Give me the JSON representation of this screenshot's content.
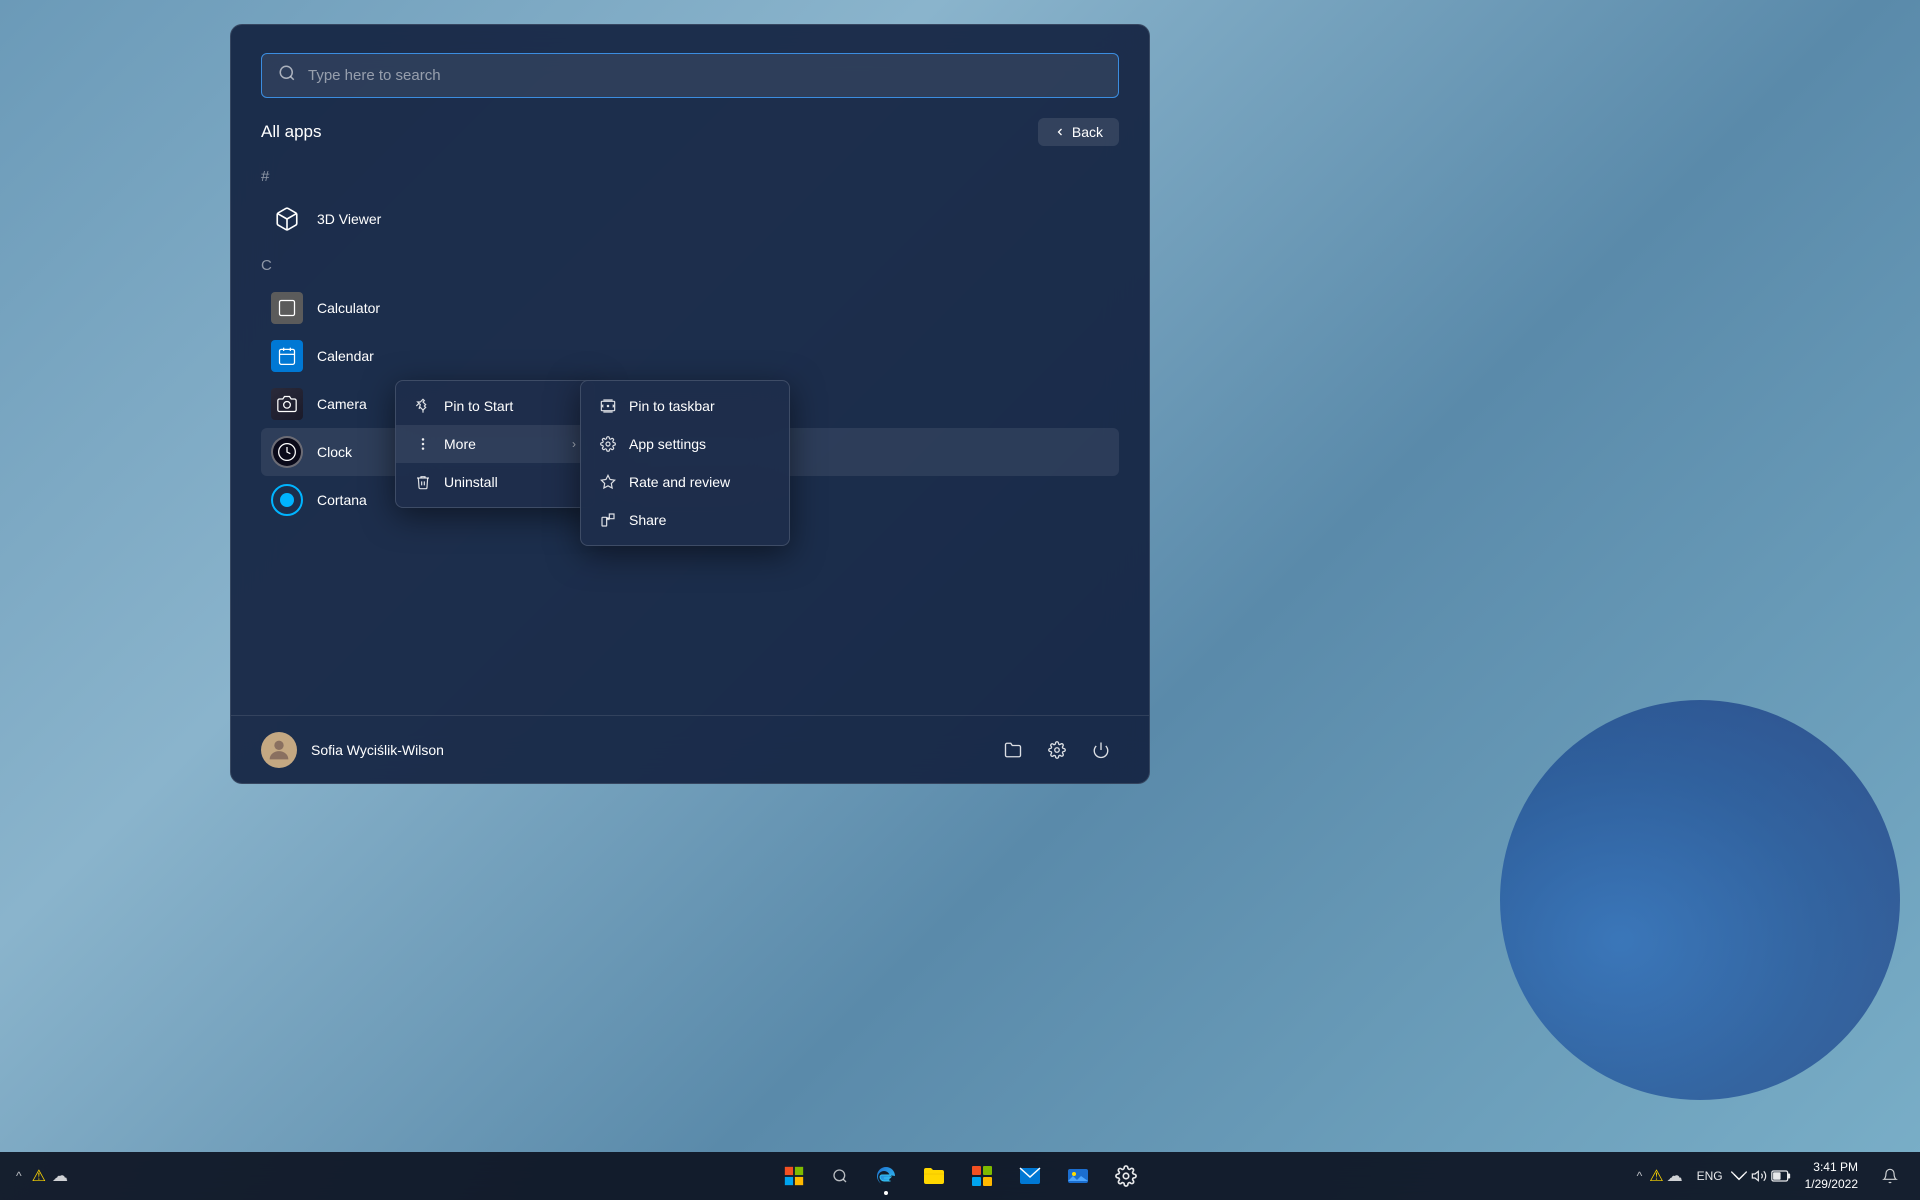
{
  "desktop": {
    "bg_color": "#6b9ab8"
  },
  "start_menu": {
    "search": {
      "placeholder": "Type here to search"
    },
    "all_apps_label": "All apps",
    "back_button": "Back",
    "sections": [
      {
        "letter": "#",
        "apps": []
      },
      {
        "letter": "",
        "apps": [
          {
            "name": "3D Viewer",
            "icon": "3dviewer"
          }
        ]
      },
      {
        "letter": "C",
        "apps": [
          {
            "name": "Calculator",
            "icon": "calculator"
          },
          {
            "name": "Calendar",
            "icon": "calendar"
          },
          {
            "name": "Camera",
            "icon": "camera"
          },
          {
            "name": "Clock",
            "icon": "clock"
          },
          {
            "name": "Cortana",
            "icon": "cortana"
          }
        ]
      }
    ]
  },
  "context_menu": {
    "items": [
      {
        "label": "Pin to Start",
        "icon": "pin"
      },
      {
        "label": "More",
        "icon": "more",
        "has_submenu": true
      },
      {
        "label": "Uninstall",
        "icon": "trash"
      }
    ]
  },
  "sub_context_menu": {
    "items": [
      {
        "label": "Pin to taskbar",
        "icon": "pin"
      },
      {
        "label": "App settings",
        "icon": "gear"
      },
      {
        "label": "Rate and review",
        "icon": "star"
      },
      {
        "label": "Share",
        "icon": "share"
      }
    ]
  },
  "user_bar": {
    "name": "Sofia Wyciślik-Wilson",
    "avatar": "👤",
    "buttons": [
      {
        "icon": "folder",
        "label": "File Explorer"
      },
      {
        "icon": "settings",
        "label": "Settings"
      },
      {
        "icon": "power",
        "label": "Power"
      }
    ]
  },
  "taskbar": {
    "icons": [
      {
        "name": "start",
        "label": "Start"
      },
      {
        "name": "search",
        "label": "Search"
      },
      {
        "name": "edge",
        "label": "Microsoft Edge"
      },
      {
        "name": "file-explorer",
        "label": "File Explorer"
      },
      {
        "name": "microsoft-store",
        "label": "Microsoft Store"
      },
      {
        "name": "mail",
        "label": "Mail"
      },
      {
        "name": "photos",
        "label": "Photos"
      },
      {
        "name": "settings",
        "label": "Settings"
      }
    ],
    "system_tray": {
      "language": "ENG",
      "time": "3:41 PM",
      "date": "1/29/2022"
    }
  }
}
